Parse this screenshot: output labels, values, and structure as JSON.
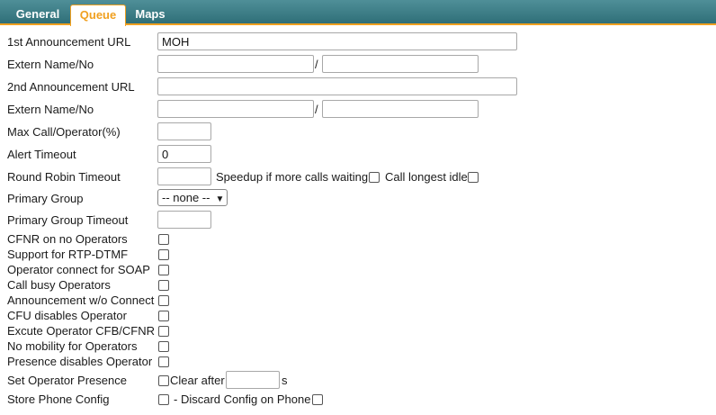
{
  "tabs": [
    {
      "label": "General",
      "active": false
    },
    {
      "label": "Queue",
      "active": true
    },
    {
      "label": "Maps",
      "active": false
    }
  ],
  "fields": {
    "announcement1": {
      "label": "1st Announcement URL",
      "value": "MOH"
    },
    "extern1": {
      "label": "Extern Name/No",
      "separator": "/",
      "value_a": "",
      "value_b": ""
    },
    "announcement2": {
      "label": "2nd Announcement URL",
      "value": ""
    },
    "extern2": {
      "label": "Extern Name/No",
      "separator": "/",
      "value_a": "",
      "value_b": ""
    },
    "max_call": {
      "label": "Max Call/Operator(%)",
      "value": ""
    },
    "alert_timeout": {
      "label": "Alert Timeout",
      "value": "0"
    },
    "round_robin": {
      "label": "Round Robin Timeout",
      "value": "",
      "speedup_label": "Speedup if more calls waiting",
      "longest_idle_label": "Call longest idle"
    },
    "primary_group": {
      "label": "Primary Group",
      "selected": "-- none --"
    },
    "primary_group_timeout": {
      "label": "Primary Group Timeout",
      "value": ""
    },
    "cfnr_no_operators": {
      "label": "CFNR on no Operators"
    },
    "rtp_dtmf": {
      "label": "Support for RTP-DTMF"
    },
    "operator_soap": {
      "label": "Operator connect for SOAP"
    },
    "call_busy": {
      "label": "Call busy Operators"
    },
    "announcement_no_connect": {
      "label": "Announcement w/o Connect"
    },
    "cfu_disables": {
      "label": "CFU disables Operator"
    },
    "excute_cfb": {
      "label": "Excute Operator CFB/CFNR"
    },
    "no_mobility": {
      "label": "No mobility for Operators"
    },
    "presence_disables": {
      "label": "Presence disables Operator"
    },
    "set_presence": {
      "label": "Set Operator Presence",
      "clear_after_label": "Clear after",
      "clear_after_value": "",
      "unit": "s"
    },
    "store_phone_config": {
      "label": "Store Phone Config",
      "discard_label": "- Discard Config on Phone"
    }
  }
}
